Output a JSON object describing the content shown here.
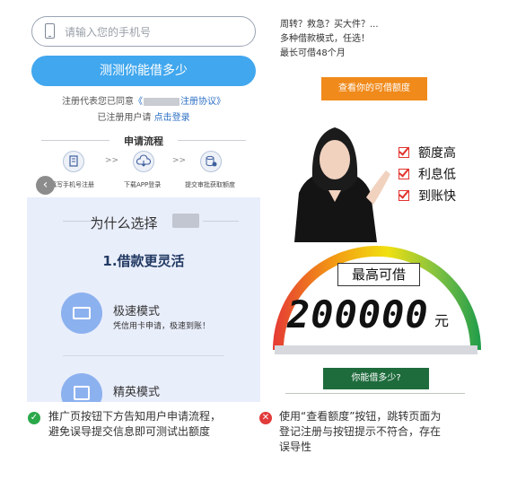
{
  "left_panel": {
    "phone_placeholder": "请输入您的手机号",
    "cta_label": "测测你能借多少",
    "agreement_prefix": "注册代表您已同意",
    "agreement_open": "《",
    "agreement_link": "注册协议》",
    "login_prefix": "已注册用户请",
    "login_link": "点击登录",
    "process_title": "申请流程",
    "steps": [
      {
        "label": "填写手机号注册",
        "icon": "form-icon"
      },
      {
        "label": "下载APP登录",
        "icon": "cloud-download-icon"
      },
      {
        "label": "提交审批获取额度",
        "icon": "coin-stack-icon"
      }
    ],
    "step_arrow": ">>",
    "back_glyph": "‹",
    "why_title": "为什么选择",
    "feature_title": "1.借款更灵活",
    "modes": [
      {
        "title": "极速模式",
        "subtitle": "凭信用卡申请，极速到账！",
        "icon": "credit-card-icon"
      },
      {
        "title": "精英模式",
        "subtitle": "",
        "icon": "document-icon"
      }
    ]
  },
  "right_panel": {
    "line1": "周转？救急？买大件？...",
    "line2": "多种借款模式，任选！",
    "line3": "最长可借48个月",
    "check_amount_button": "查看你的可借额度",
    "checks": [
      "额度高",
      "利息低",
      "到账快"
    ],
    "max_label": "最高可借",
    "amount": "200000",
    "unit": "元",
    "how_much_button": "你能借多少?"
  },
  "captions": [
    {
      "status": "good",
      "icon": "check-circle-icon",
      "color": "#2aa84a",
      "lines": [
        "推广页按钮下方告知用户申请流程，",
        "避免误导提交信息即可测试出额度"
      ]
    },
    {
      "status": "bad",
      "icon": "cross-circle-icon",
      "color": "#e23b3b",
      "lines": [
        "使用“查看额度”按钮，跳转页面为",
        "登记注册与按钮提示不符合，存在",
        "误导性"
      ]
    }
  ],
  "colors": {
    "primary_blue": "#41a7ee",
    "orange": "#f08a1b",
    "dark_green": "#1e6b3c",
    "good": "#2aa84a",
    "bad": "#e23b3b",
    "check_red": "#e2322c"
  }
}
